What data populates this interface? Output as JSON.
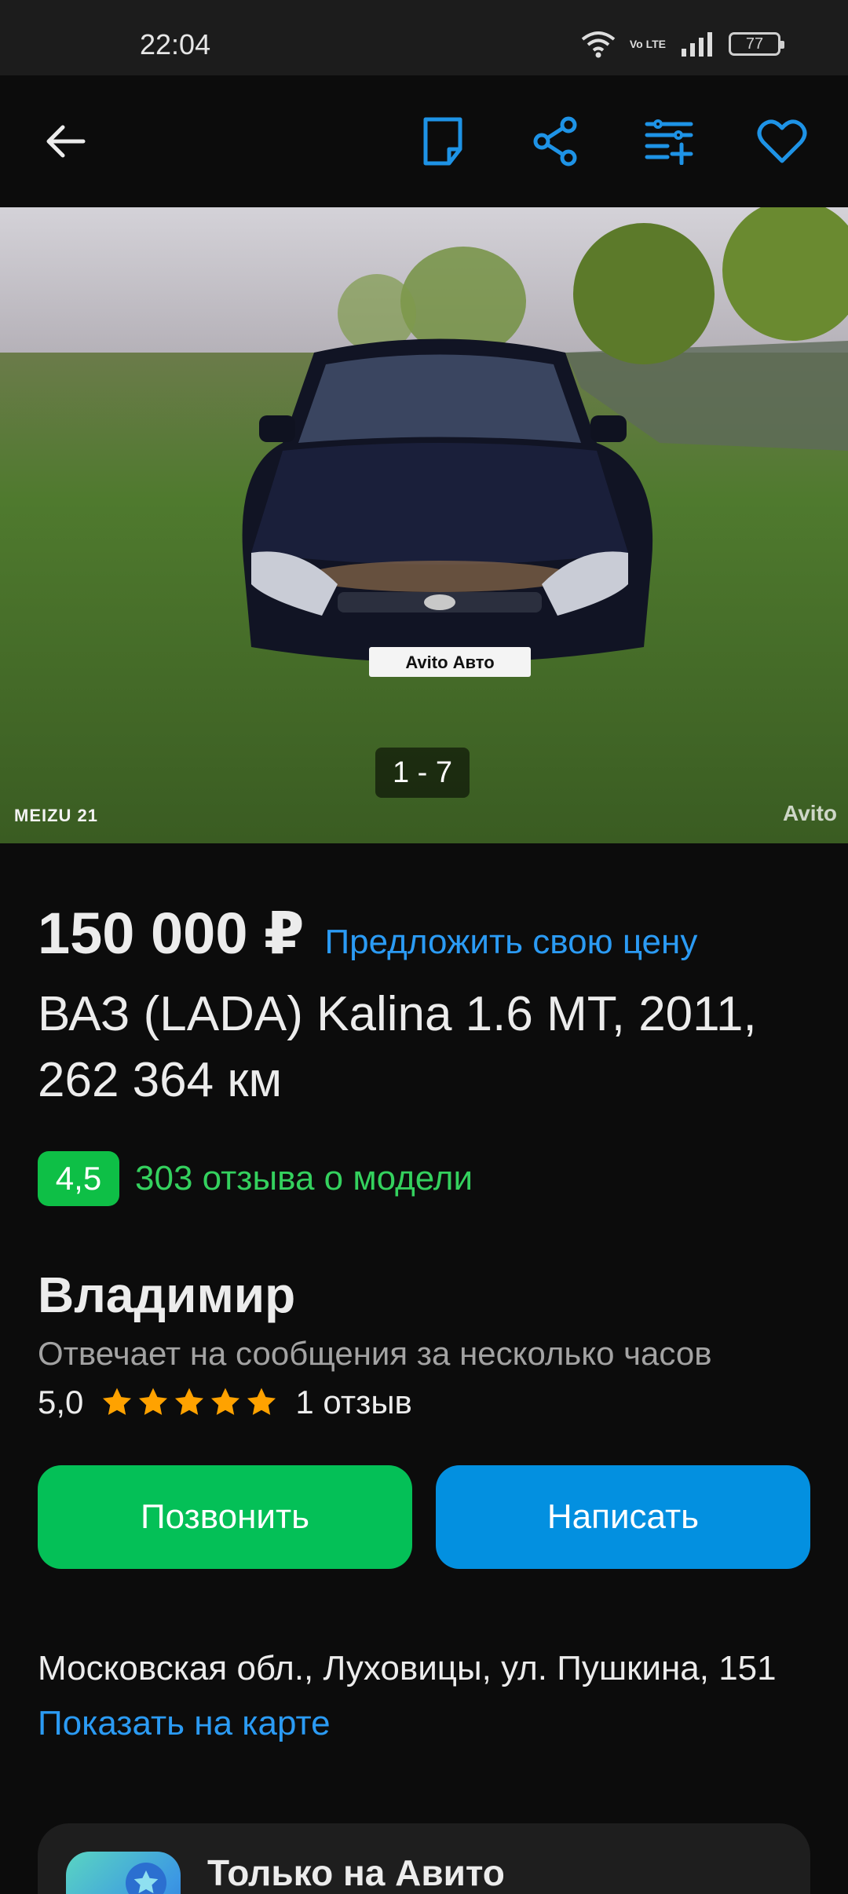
{
  "status_bar": {
    "time": "22:04",
    "network": "Vo LTE",
    "battery": "77",
    "icons": [
      "wifi-icon",
      "volte-icon",
      "signal-icon",
      "battery-icon"
    ]
  },
  "toolbar": {
    "icons": [
      "back-arrow-icon",
      "note-icon",
      "share-icon",
      "compare-icon",
      "heart-icon"
    ]
  },
  "gallery": {
    "counter": "1 - 7",
    "camera_watermark": "MEIZU 21",
    "avito_watermark": "Avito",
    "plate_text": "Avito Авто"
  },
  "listing": {
    "price": "150 000 ₽",
    "offer_link": "Предложить свою цену",
    "title": "ВАЗ (LADA) Kalina 1.6 MT, 2011, 262 364 км"
  },
  "model_rating": {
    "score": "4,5",
    "reviews_link": "303 отзыва о модели"
  },
  "seller": {
    "name": "Владимир",
    "response_time": "Отвечает на сообщения за несколько часов",
    "rating": "5,0",
    "stars": 5,
    "reviews": "1 отзыв"
  },
  "actions": {
    "call": "Позвонить",
    "write": "Написать"
  },
  "location": {
    "address": "Московская обл., Луховицы, ул. Пушкина, 151",
    "map_link": "Показать на карте"
  },
  "promo": {
    "title": "Только на Авито"
  },
  "colors": {
    "accent_blue": "#0390e0",
    "call_green": "#04c057",
    "rating_green": "#0ebf46",
    "link_blue": "#2b9bf4",
    "star_orange": "#ffa200"
  }
}
